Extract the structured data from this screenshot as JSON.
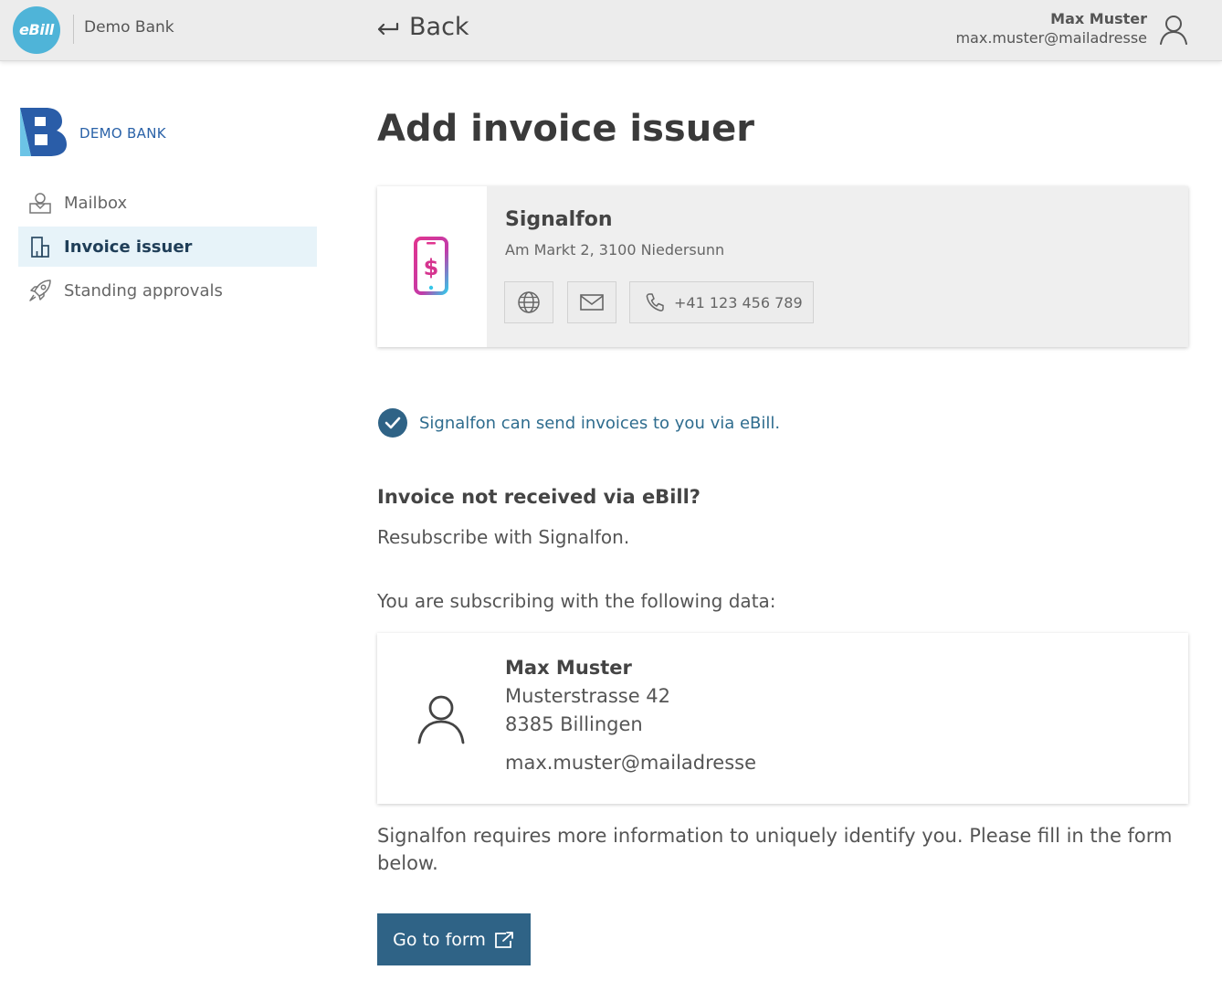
{
  "header": {
    "logo_text": "eBill",
    "bank_name": "Demo Bank",
    "back_label": "Back",
    "user_name": "Max Muster",
    "user_email": "max.muster@mailadresse"
  },
  "sidebar": {
    "bank_logo_text": "DEMO BANK",
    "items": [
      {
        "label": "Mailbox",
        "icon": "mailbox-icon",
        "active": false
      },
      {
        "label": "Invoice issuer",
        "icon": "building-icon",
        "active": true
      },
      {
        "label": "Standing approvals",
        "icon": "rocket-icon",
        "active": false
      }
    ]
  },
  "main": {
    "title": "Add invoice issuer",
    "issuer": {
      "name": "Signalfon",
      "address": "Am Markt 2, 3100 Niedersunn",
      "phone": "+41 123 456 789",
      "logo_icon": "phone-dollar-icon"
    },
    "confirmation": "Signalfon can send invoices to you via eBill.",
    "question": "Invoice not received via eBill?",
    "resubscribe": "Resubscribe with Signalfon.",
    "subscribing_label": "You are subscribing with the following data:",
    "subscriber": {
      "name": "Max Muster",
      "street": "Musterstrasse 42",
      "city": "8385 Billingen",
      "email": "max.muster@mailadresse"
    },
    "requires_text": "Signalfon requires more information to uniquely identify you. Please fill in the form below.",
    "button_label": "Go to form"
  },
  "colors": {
    "accent": "#2f6386",
    "ebill_blue": "#4fb4d8",
    "active_nav_bg": "#e7f3f9",
    "check_text": "#2e6c8e"
  }
}
